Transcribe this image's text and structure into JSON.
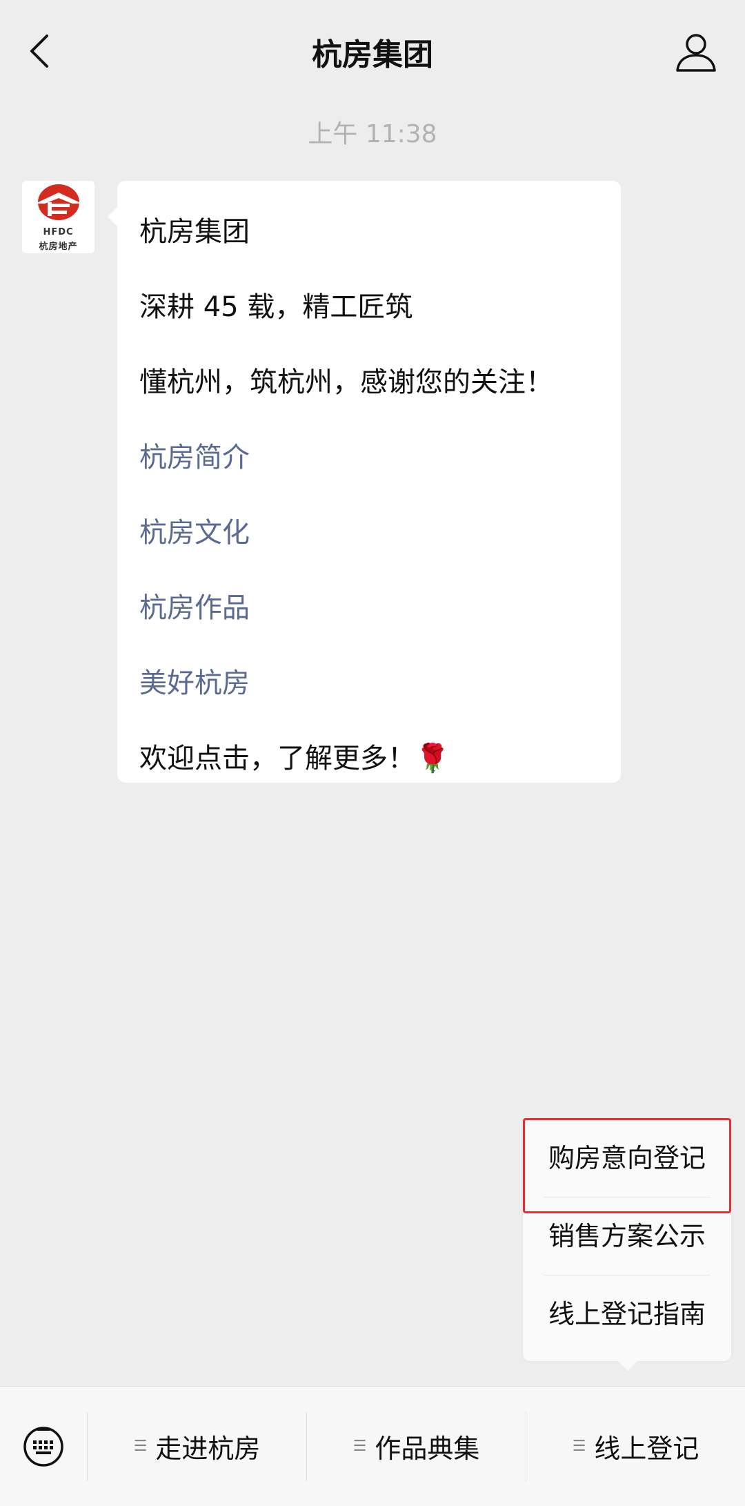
{
  "header": {
    "title": "杭房集团"
  },
  "timestamp": "上午 11:38",
  "avatar": {
    "logo_text": "HFDC",
    "logo_subtext": "杭房地产"
  },
  "message": {
    "lines": [
      {
        "text": "杭房集团",
        "link": false
      },
      {
        "text": "深耕 45 载，精工匠筑",
        "link": false
      },
      {
        "text": "懂杭州，筑杭州，感谢您的关注！",
        "link": false
      },
      {
        "text": "杭房简介",
        "link": true
      },
      {
        "text": "杭房文化",
        "link": true
      },
      {
        "text": "杭房作品",
        "link": true
      },
      {
        "text": "美好杭房",
        "link": true
      },
      {
        "text": "欢迎点击，了解更多！🌹",
        "link": false
      }
    ]
  },
  "popup": {
    "items": [
      "购房意向登记",
      "销售方案公示",
      "线上登记指南"
    ],
    "highlight_color": "#e23030"
  },
  "menubar": {
    "items": [
      "走进杭房",
      "作品典集",
      "线上登记"
    ],
    "keyboard_icon": "keyboard-icon",
    "menu_icon": "menu-lines-icon"
  },
  "colors": {
    "link": "#5b6a91",
    "background": "#ededed",
    "accent_red": "#e23030"
  }
}
